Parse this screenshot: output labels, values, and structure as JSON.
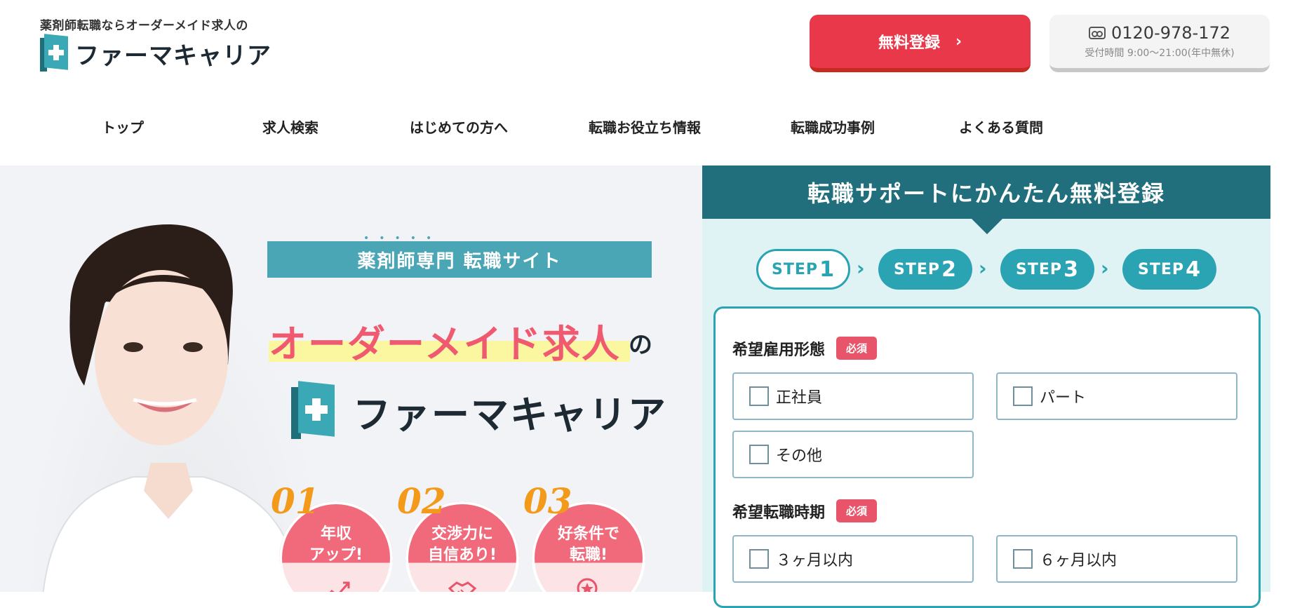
{
  "header": {
    "tagline": "薬剤師転職ならオーダーメイド求人の",
    "logo_text": "ファーマキャリア",
    "register_label": "無料登録",
    "register_chevron": "›",
    "phone_number": "0120-978-172",
    "phone_hours": "受付時間 9:00〜21:00(年中無休)"
  },
  "nav": {
    "items": [
      "トップ",
      "求人検索",
      "はじめての方へ",
      "転職お役立ち情報",
      "転職成功事例",
      "よくある質問"
    ]
  },
  "hero": {
    "dots": "•••••",
    "banner": "薬剤師専門 転職サイト",
    "catch": "オーダーメイド求人",
    "catch_no": "の",
    "logo_text": "ファーマキャリア",
    "features": [
      {
        "num": "01",
        "line1": "年収",
        "line2": "アップ!",
        "icon": "chart-up-icon"
      },
      {
        "num": "02",
        "line1": "交渉力に",
        "line2": "自信あり!",
        "icon": "handshake-icon"
      },
      {
        "num": "03",
        "line1": "好条件で",
        "line2": "転職!",
        "icon": "search-star-icon"
      }
    ]
  },
  "panel": {
    "title": "転職サポートにかんたん無料登録",
    "steps": [
      {
        "prefix": "STEP",
        "num": "1",
        "state": "active"
      },
      {
        "prefix": "STEP",
        "num": "2",
        "state": "todo"
      },
      {
        "prefix": "STEP",
        "num": "3",
        "state": "todo"
      },
      {
        "prefix": "STEP",
        "num": "4",
        "state": "todo"
      }
    ],
    "step_sep": "›",
    "employment": {
      "label": "希望雇用形態",
      "required": "必須",
      "options": [
        "正社員",
        "パート",
        "その他"
      ]
    },
    "timing": {
      "label": "希望転職時期",
      "required": "必須",
      "options": [
        "３ヶ月以内",
        "６ヶ月以内"
      ]
    }
  },
  "colors": {
    "accent_red": "#e8384a",
    "teal_dark": "#216f7c",
    "teal": "#2aa3b2",
    "pink": "#f05a70"
  }
}
